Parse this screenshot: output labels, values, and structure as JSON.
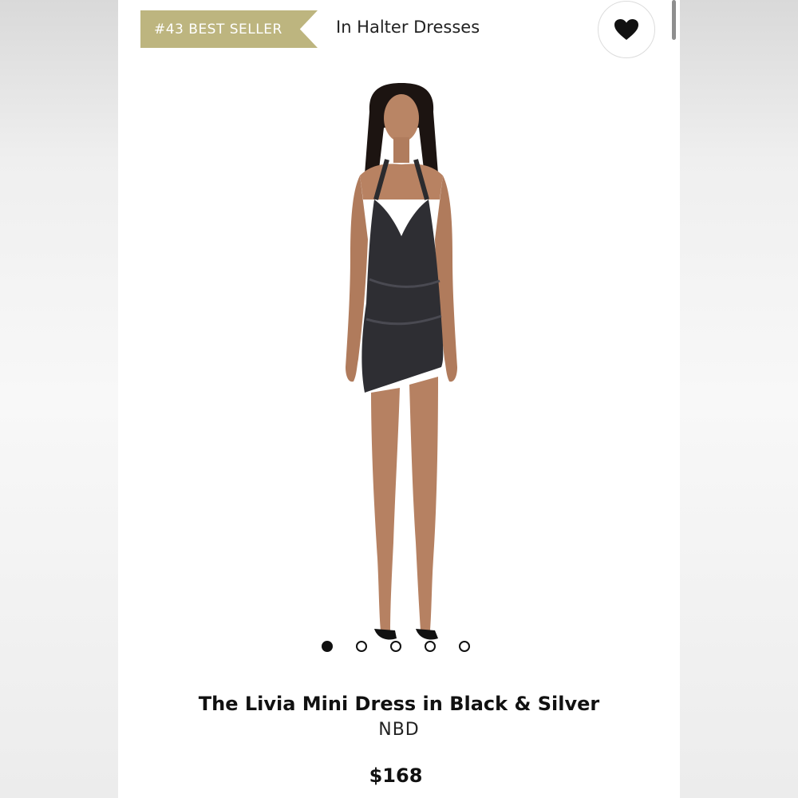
{
  "header": {
    "badge_label": "#43 BEST SELLER",
    "category_label": "In Halter Dresses",
    "favorite_icon": "heart-icon"
  },
  "gallery": {
    "image_count": 5,
    "active_index": 0
  },
  "product": {
    "title": "The Livia Mini Dress in Black & Silver",
    "brand": "NBD",
    "price": "$168"
  },
  "colors": {
    "badge": "#bdb57f",
    "text": "#111111"
  }
}
